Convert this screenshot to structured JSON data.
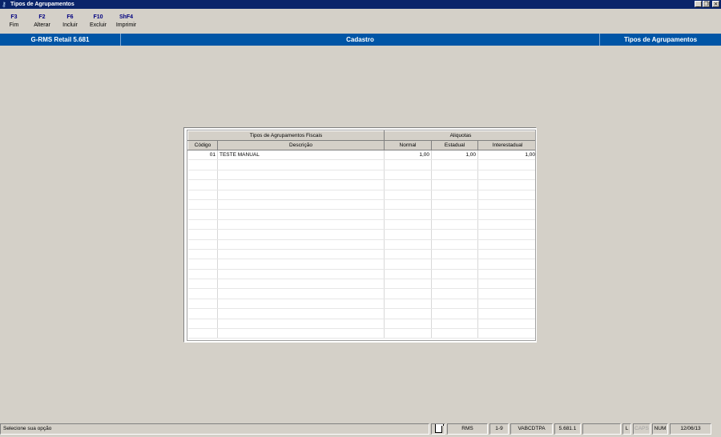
{
  "window": {
    "title": "Tipos de Agrupamentos",
    "controls": [
      "minimize",
      "restore",
      "close"
    ]
  },
  "toolbar": [
    {
      "key": "F3",
      "label": "Fim"
    },
    {
      "key": "F2",
      "label": "Alterar"
    },
    {
      "key": "F6",
      "label": "Incluir"
    },
    {
      "key": "F10",
      "label": "Excluir"
    },
    {
      "key": "ShF4",
      "label": "Imprimir"
    }
  ],
  "header": {
    "app": "G-RMS Retail 5.681",
    "section": "Cadastro",
    "screen": "Tipos de Agrupamentos"
  },
  "grid": {
    "group_headers": {
      "fiscal": "Tipos de Agrupamentos Fiscais",
      "aliquotas": "Aliquotas"
    },
    "columns": [
      "Código",
      "Descrição",
      "Normal",
      "Estadual",
      "Interestadual"
    ],
    "rows": [
      {
        "codigo": "01",
        "descricao": "TESTE MANUAL",
        "normal": "1,00",
        "estadual": "1,00",
        "interestadual": "1,00"
      }
    ]
  },
  "status": {
    "message": "Selecione sua opção",
    "module": "RMS",
    "range": "1-9",
    "code": "VABCDTPA",
    "version": "5.681.1",
    "blank": "",
    "l": "L",
    "caps": "CAPS",
    "num": "NUM",
    "date": "12/06/13"
  },
  "icons": {
    "app": "key-icon",
    "status_doc": "document-icon"
  }
}
